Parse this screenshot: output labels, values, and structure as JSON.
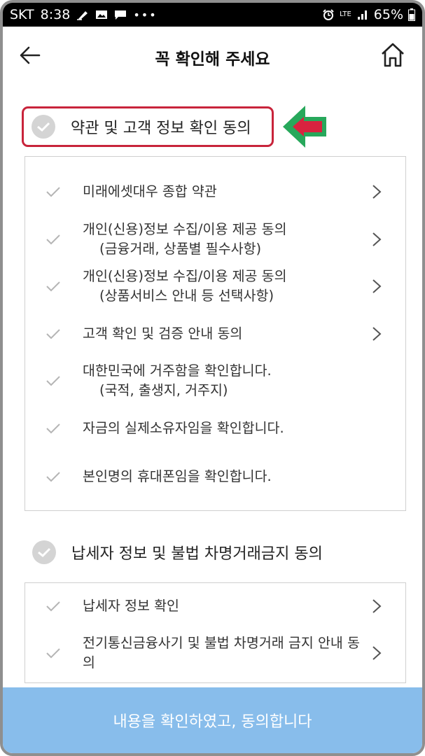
{
  "status_bar": {
    "carrier": "SKT",
    "time": "8:38",
    "network": "LTE",
    "battery": "65%"
  },
  "header": {
    "title": "꼭 확인해 주세요",
    "back_icon": "arrow-left-icon",
    "home_icon": "home-icon"
  },
  "section1": {
    "label": "약관 및 고객 정보 확인 동의",
    "highlight_color": "#c8243b",
    "arrow_color": "#27a85b",
    "items": [
      {
        "line1": "미래에셋대우 종합 약관",
        "line2": "",
        "has_chevron": true
      },
      {
        "line1": "개인(신용)정보 수집/이용 제공 동의",
        "line2": "(금융거래, 상품별 필수사항)",
        "has_chevron": true
      },
      {
        "line1": "개인(신용)정보 수집/이용 제공 동의",
        "line2": "(상품서비스 안내 등 선택사항)",
        "has_chevron": true
      },
      {
        "line1": "고객 확인 및 검증 안내 동의",
        "line2": "",
        "has_chevron": true
      },
      {
        "line1": "대한민국에 거주함을 확인합니다.",
        "line2": "(국적, 출생지, 거주지)",
        "has_chevron": false
      },
      {
        "line1": "자금의 실제소유자임을 확인합니다.",
        "line2": "",
        "has_chevron": false
      },
      {
        "line1": "본인명의 휴대폰임을 확인합니다.",
        "line2": "",
        "has_chevron": false
      }
    ]
  },
  "section2": {
    "label": "납세자 정보 및 불법 차명거래금지 동의",
    "items": [
      {
        "line1": "납세자 정보 확인",
        "line2": "",
        "has_chevron": true
      },
      {
        "line1": "전기통신금융사기 및 불법 차명거래 금지 안내 동의",
        "line2": "",
        "has_chevron": true
      }
    ]
  },
  "submit": {
    "label": "내용을 확인하였고, 동의합니다",
    "color": "#88bdeb"
  }
}
